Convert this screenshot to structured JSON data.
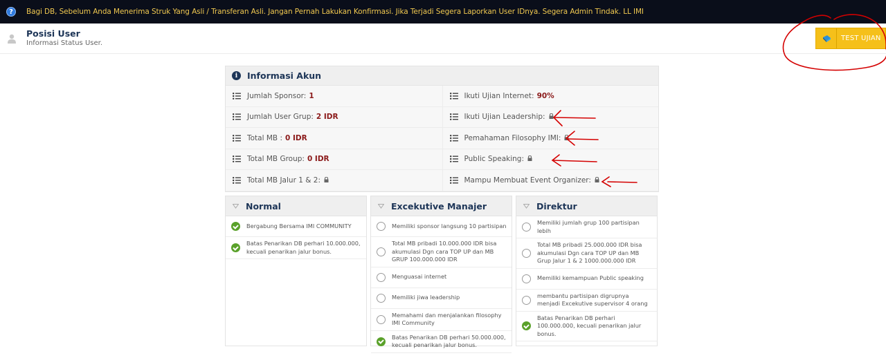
{
  "topbar": {
    "help_icon": "question-circle-icon",
    "announcement": "Bagi DB, Sebelum Anda Menerima Struk Yang Asli / Transferan Asli. Jangan Pernah Lakukan Konfirmasi. Jika Terjadi Segera Laporkan User IDnya. Segera Admin Tindak. LL IMI"
  },
  "header": {
    "icon": "user-icon",
    "title": "Posisi User",
    "subtitle": "Informasi Status User.",
    "test_button": {
      "icon": "book-icon",
      "label": "TEST UJIAN"
    }
  },
  "info_panel": {
    "icon": "info-circle-icon",
    "title": "Informasi Akun",
    "left_rows": [
      {
        "label": "Jumlah Sponsor:",
        "value": "1",
        "locked": false
      },
      {
        "label": "Jumlah User Grup:",
        "value": "2  IDR",
        "locked": false
      },
      {
        "label": "Total MB :",
        "value": "0  IDR",
        "locked": false
      },
      {
        "label": "Total MB Group:",
        "value": "0  IDR",
        "locked": false
      },
      {
        "label": "Total MB Jalur 1 & 2:",
        "value": "",
        "locked": true
      }
    ],
    "right_rows": [
      {
        "label": "Ikuti Ujian Internet:",
        "value": "90%",
        "locked": false
      },
      {
        "label": "Ikuti Ujian Leadership:",
        "value": "",
        "locked": true
      },
      {
        "label": "Pemahaman Filosophy IMI:",
        "value": "",
        "locked": true
      },
      {
        "label": "Public Speaking:",
        "value": "",
        "locked": true
      },
      {
        "label": "Mampu Membuat Event Organizer:",
        "value": "",
        "locked": true
      }
    ]
  },
  "levels": [
    {
      "title": "Normal",
      "items": [
        {
          "text": "Bergabung Bersama IMI COMMUNITY",
          "done": true
        },
        {
          "text": "Batas Penarikan DB perhari 10.000.000, kecuali penarikan jalur bonus.",
          "done": true
        }
      ]
    },
    {
      "title": "Excekutive Manajer",
      "items": [
        {
          "text": "Memiliki sponsor langsung 10 partisipan",
          "done": false
        },
        {
          "text": "Total MB pribadi 10.000.000 IDR bisa akumulasi Dgn cara TOP UP dan MB GRUP 100.000.000 IDR",
          "done": false
        },
        {
          "text": "Menguasai internet",
          "done": false
        },
        {
          "text": "Memiliki jiwa leadership",
          "done": false
        },
        {
          "text": "Memahami dan menjalankan filosophy IMI Community",
          "done": false
        },
        {
          "text": "Batas Penarikan DB perhari 50.000.000, kecuali penarikan jalur bonus.",
          "done": true
        }
      ]
    },
    {
      "title": "Direktur",
      "items": [
        {
          "text": "Memiliki jumlah grup 100 partisipan lebih",
          "done": false
        },
        {
          "text": "Total MB pribadi 25.000.000 IDR bisa akumulasi Dgn cara TOP UP dan MB Grup Jalur 1 & 2 1000.000.000 IDR",
          "done": false
        },
        {
          "text": "Memiliki kemampuan Public speaking",
          "done": false
        },
        {
          "text": "membantu partisipan digrupnya menjadi Excekutive supervisor 4 orang",
          "done": false
        },
        {
          "text": "Batas Penarikan DB perhari 100.000.000, kecuali penarikan jalur bonus.",
          "done": true
        }
      ]
    }
  ],
  "annotation_color": "#d40000"
}
